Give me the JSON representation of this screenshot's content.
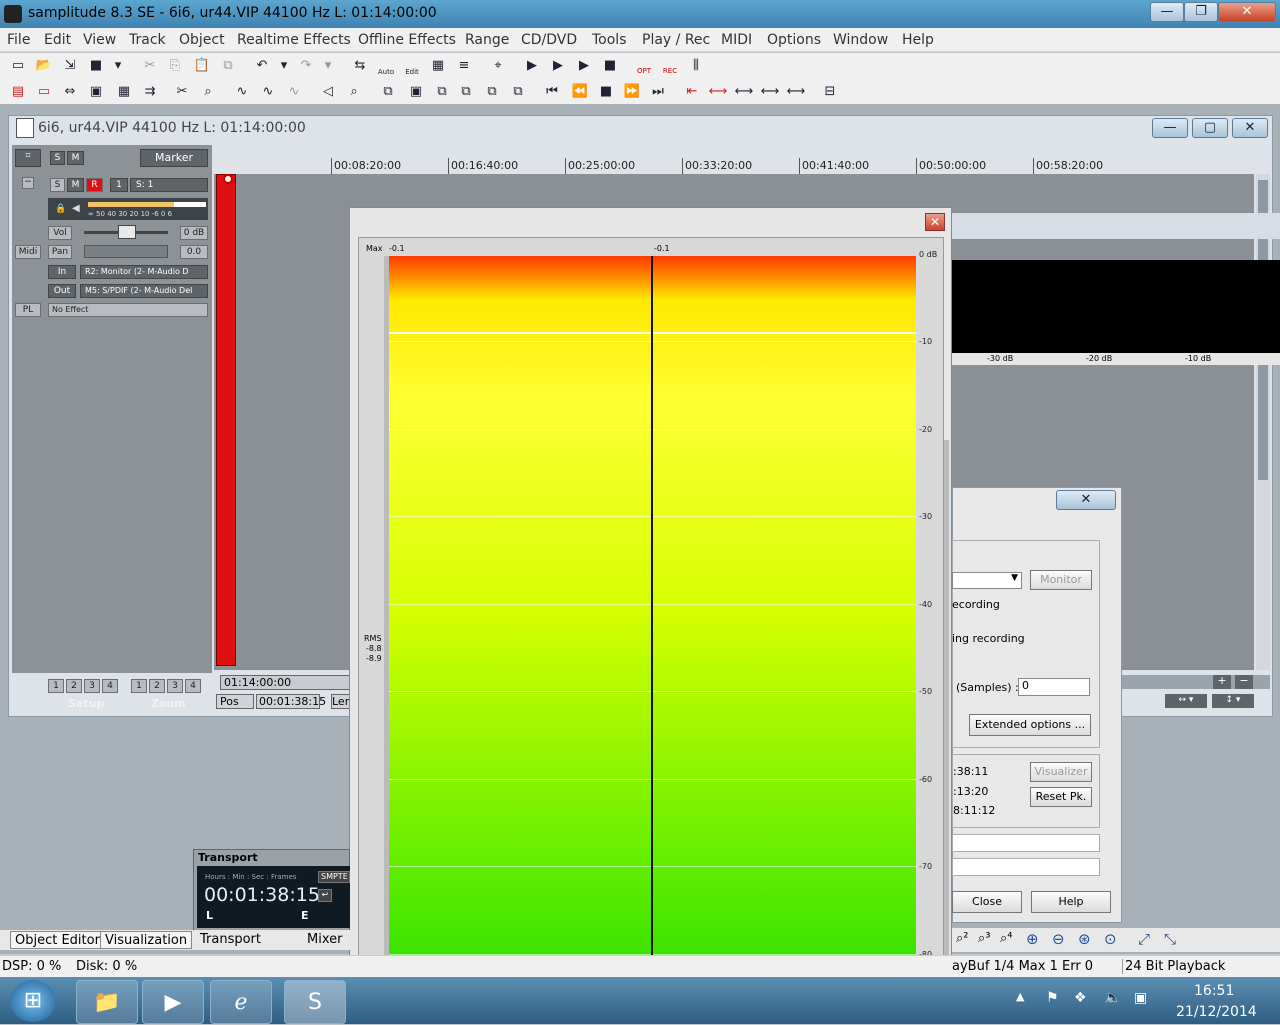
{
  "window": {
    "title": "samplitude 8.3 SE  - 6i6, ur44.VIP   44100 Hz L: 01:14:00:00",
    "minimize": "—",
    "restore": "❐",
    "close": "✕"
  },
  "menu": [
    "File",
    "Edit",
    "View",
    "Track",
    "Object",
    "Realtime Effects",
    "Offline Effects",
    "Range",
    "CD/DVD",
    "Tools",
    "Play / Rec",
    "MIDI",
    "Options",
    "Window",
    "Help"
  ],
  "toolbar": {
    "auto": "Auto",
    "edit": "Edit",
    "opt": "OPT",
    "rec": "REC"
  },
  "project": {
    "title": "6i6, ur44.VIP   44100 Hz L: 01:14:00:00"
  },
  "track": {
    "s": "S",
    "m": "M",
    "r": "R",
    "marker": "Marker",
    "num": "1",
    "s1": "S: 1",
    "meter_scale": "∞  50 40 30 20  10 -6   0   6",
    "vol_label": "Vol",
    "vol_value": "0 dB",
    "pan_label": "Pan",
    "pan_value": "0.0",
    "midi": "Midi",
    "in_label": "In",
    "in_value": "R2: Monitor (2- M-Audio D",
    "out_label": "Out",
    "out_value": "M5: S/PDIF (2- M-Audio Del",
    "pl": "PL",
    "effect": "No Effect"
  },
  "setup": {
    "label": "Setup",
    "nums": [
      "1",
      "2",
      "3",
      "4"
    ]
  },
  "zoom": {
    "label": "Zoom",
    "nums": [
      "1",
      "2",
      "3",
      "4"
    ]
  },
  "position": {
    "time": "01:14:00:00",
    "pos_label": "Pos",
    "pos_value": "00:01:38:15",
    "len_label": "Len"
  },
  "ruler": [
    "00:08:20:00",
    "00:16:40:00",
    "00:25:00:00",
    "00:33:20:00",
    "00:41:40:00",
    "00:50:00:00",
    "00:58:20:00"
  ],
  "meter": {
    "max_label": "Max",
    "left_peak": "-0.1",
    "right_peak": "-0.1",
    "rms": "RMS",
    "rms_l": "-8.8",
    "rms_r": "-8.9",
    "db_labels": [
      "0 dB",
      "-10",
      "-20",
      "-30",
      "-40",
      "-50",
      "-60",
      "-70",
      "-80"
    ]
  },
  "blackmeter": {
    "labels": [
      "-30 dB",
      "-20 dB",
      "-10 dB"
    ]
  },
  "recdialog": {
    "monitor": "Monitor",
    "recording1": "ecording",
    "recording2": "ing recording",
    "samples_label": "(Samples) :",
    "samples_value": "0",
    "extended": "Extended options ...",
    "visualizer": "Visualizer",
    "t1": ":38:11",
    "t2": ":13:20",
    "t3": "8:11:12",
    "reset": "Reset Pk.",
    "close": "Close",
    "help": "Help"
  },
  "transport": {
    "title": "Transport",
    "units": "Hours : Min : Sec : Frames",
    "smpte": "SMPTE",
    "time": "00:01:38:15",
    "l": "L",
    "e": "E"
  },
  "tabs": [
    "Object Editor",
    "Visualization",
    "Transport",
    "Mixer"
  ],
  "status": {
    "dsp": "DSP: 0 %",
    "disk": "Disk: 0 %",
    "playbuf": "ayBuf 1/4  Max 1  Err 0",
    "bit": "24 Bit Playback"
  },
  "clock": {
    "time": "16:51",
    "date": "21/12/2014"
  }
}
